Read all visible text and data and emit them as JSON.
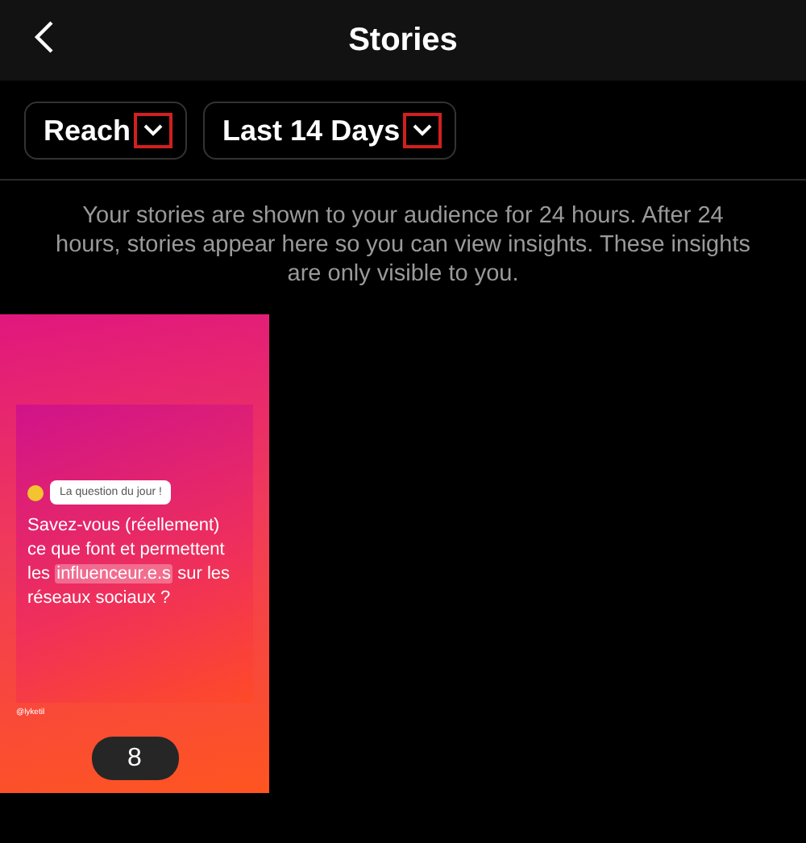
{
  "header": {
    "title": "Stories"
  },
  "filters": [
    {
      "label": "Reach",
      "highlighted": true
    },
    {
      "label": "Last 14 Days",
      "highlighted": true
    }
  ],
  "info": "Your stories are shown to your audience for 24 hours. After 24 hours, stories appear here so you can view insights. These insights are only visible to you.",
  "stories": [
    {
      "question_label": "La question du jour !",
      "question": "Savez-vous (réellement) ce que font et permettent les **influenceur.e.s** sur les réseaux sociaux ?",
      "handle": "@lyketil",
      "count": "8"
    }
  ]
}
